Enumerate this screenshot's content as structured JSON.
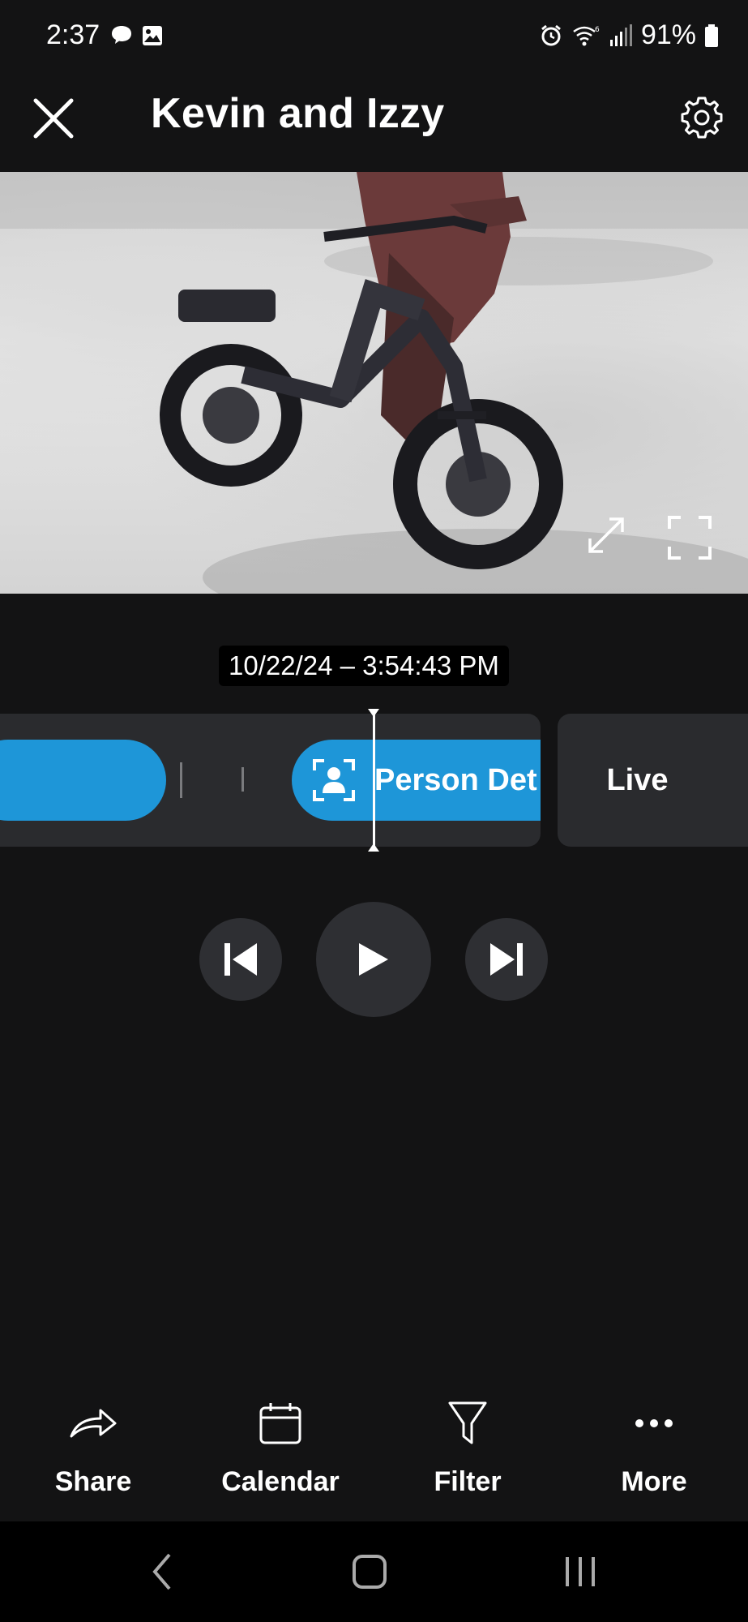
{
  "status_bar": {
    "time": "2:37",
    "battery": "91%",
    "left_icons": [
      "chat-bubble-icon",
      "image-icon"
    ],
    "right_icons": [
      "alarm-icon",
      "wifi-icon",
      "signal-icon",
      "battery-icon"
    ]
  },
  "header": {
    "title": "Kevin and Izzy",
    "close_icon": "close-icon",
    "settings_icon": "gear-icon"
  },
  "video": {
    "expand_icon": "expand-arrows-icon",
    "fullscreen_icon": "fullscreen-icon"
  },
  "timeline": {
    "timestamp": "10/22/24 – 3:54:43 PM",
    "event_label": "Person Det",
    "event_icon": "person-detect-icon",
    "live_label": "Live"
  },
  "controls": {
    "prev_icon": "skip-previous-icon",
    "play_icon": "play-icon",
    "next_icon": "skip-next-icon"
  },
  "toolbar": {
    "items": [
      {
        "label": "Share",
        "icon": "share-icon"
      },
      {
        "label": "Calendar",
        "icon": "calendar-icon"
      },
      {
        "label": "Filter",
        "icon": "filter-icon"
      },
      {
        "label": "More",
        "icon": "more-icon"
      }
    ]
  },
  "colors": {
    "background": "#131314",
    "accent": "#1e96d8",
    "panel": "#2a2b2e"
  }
}
